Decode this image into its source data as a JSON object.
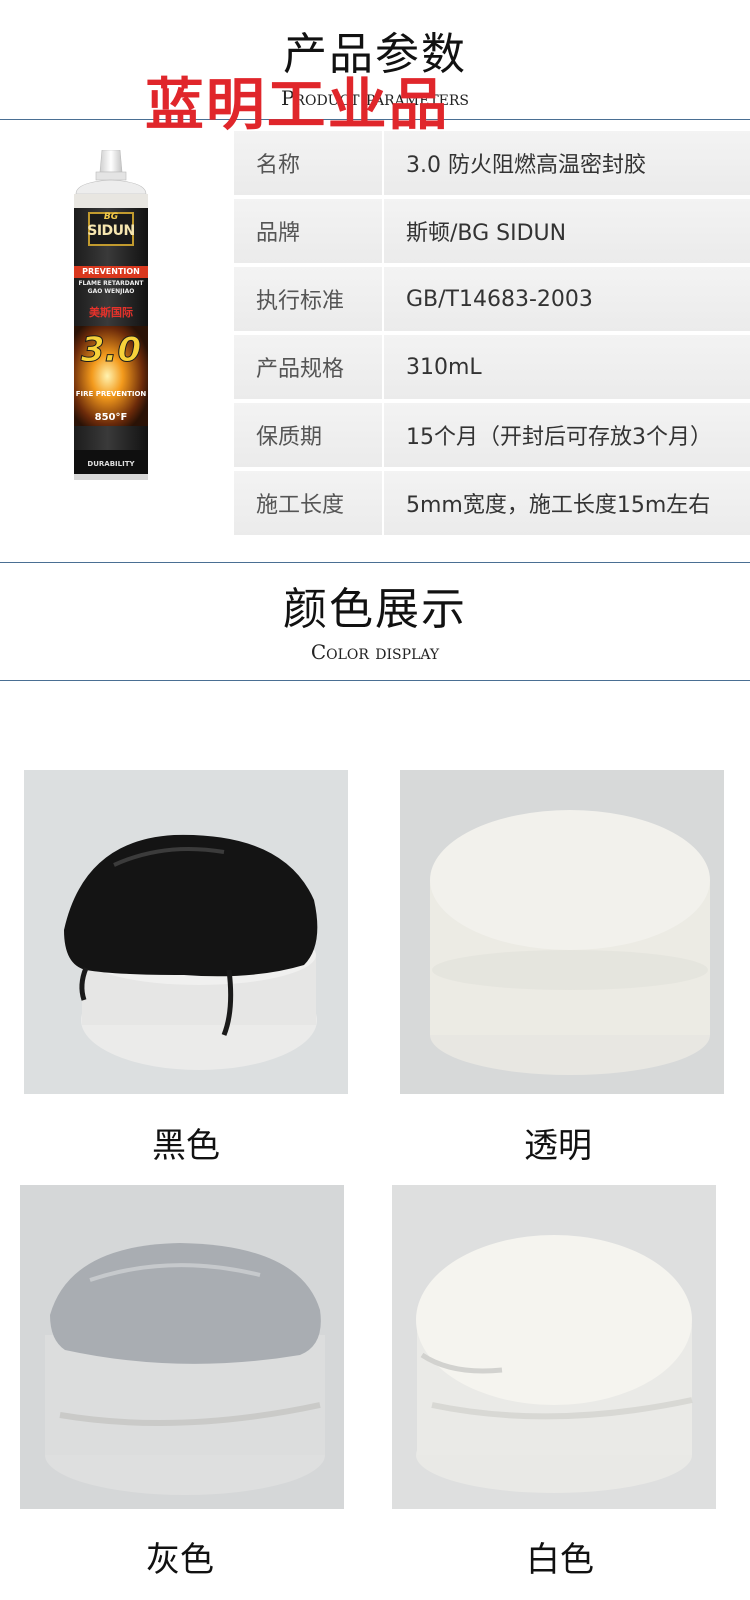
{
  "section_params": {
    "title_cn": "产品参数",
    "title_en": "Product parameters"
  },
  "watermark": "蓝明工业品",
  "product_image": {
    "brand_logo": "BG",
    "brand_name": "SIDUN",
    "line1": "PREVENTION",
    "line2": "FLAME RETARDANT",
    "line3": "GAO WENJIAO",
    "line4": "美斯国际",
    "big_label": "3.0",
    "line5": "FIRE PREVENTION",
    "temp": "850°F",
    "bottom": "DURABILITY"
  },
  "specs": [
    {
      "label": "名称",
      "value": "3.0 防火阻燃高温密封胶"
    },
    {
      "label": "品牌",
      "value": "斯顿/BG SIDUN"
    },
    {
      "label": "执行标准",
      "value": "GB/T14683-2003"
    },
    {
      "label": "产品规格",
      "value": "310mL"
    },
    {
      "label": "保质期",
      "value": "15个月（开封后可存放3个月）"
    },
    {
      "label": "施工长度",
      "value": "5mm宽度，施工长度15m左右"
    }
  ],
  "section_colors": {
    "title_cn": "颜色展示",
    "title_en": "Color display"
  },
  "colors": [
    {
      "label": "黑色",
      "hex": "#141414"
    },
    {
      "label": "透明",
      "hex": "#ecebe4"
    },
    {
      "label": "灰色",
      "hex": "#a9adb2"
    },
    {
      "label": "白色",
      "hex": "#f4f3ee"
    }
  ]
}
